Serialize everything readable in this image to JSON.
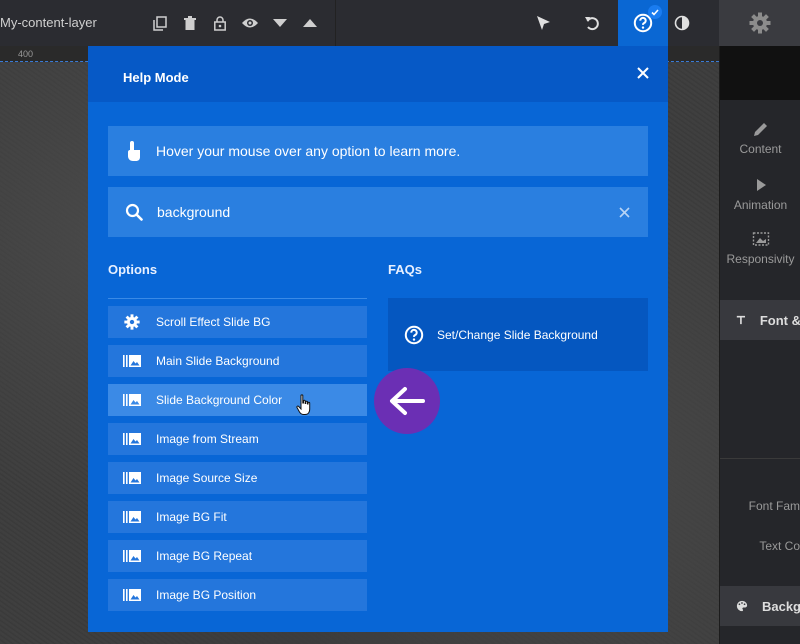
{
  "toolbar": {
    "layer_name": "My-content-layer",
    "icons": [
      "duplicate-icon",
      "trash-icon",
      "lock-icon",
      "eye-icon",
      "arrow-down-icon",
      "arrow-up-icon",
      "pointer-icon",
      "undo-icon",
      "help-icon",
      "contrast-icon",
      "gear-icon"
    ]
  },
  "ruler": {
    "mark": "400"
  },
  "right_panel": {
    "nav": [
      {
        "label": "Content",
        "icon": "pencil-icon"
      },
      {
        "label": "Animation",
        "icon": "play-icon"
      },
      {
        "label": "Responsivity",
        "icon": "responsive-icon"
      }
    ],
    "font_row": "Font &",
    "font_family_label": "Font Fam",
    "text_color_label": "Text Co",
    "background_row": "Backg"
  },
  "help_modal": {
    "title": "Help Mode",
    "hint": "Hover your mouse over any option to learn more.",
    "search": {
      "value": "background"
    },
    "options_title": "Options",
    "faqs_title": "FAQs",
    "options": [
      {
        "label": "Scroll Effect Slide BG",
        "icon": "gear-icon"
      },
      {
        "label": "Main Slide Background",
        "icon": "bg-image-icon"
      },
      {
        "label": "Slide Background Color",
        "icon": "bg-image-icon",
        "hovered": true
      },
      {
        "label": "Image from Stream",
        "icon": "bg-image-icon"
      },
      {
        "label": "Image Source Size",
        "icon": "bg-image-icon"
      },
      {
        "label": "Image BG Fit",
        "icon": "bg-image-icon"
      },
      {
        "label": "Image BG Repeat",
        "icon": "bg-image-icon"
      },
      {
        "label": "Image BG Position",
        "icon": "bg-image-icon"
      }
    ],
    "faqs": [
      {
        "label": "Set/Change Slide Background",
        "icon": "question-circle-icon"
      }
    ]
  },
  "colors": {
    "modal_bg": "#0866d6",
    "modal_header": "#0659c6",
    "option_bg": "#2476dc",
    "arrow_badge": "#6b2fb4"
  }
}
